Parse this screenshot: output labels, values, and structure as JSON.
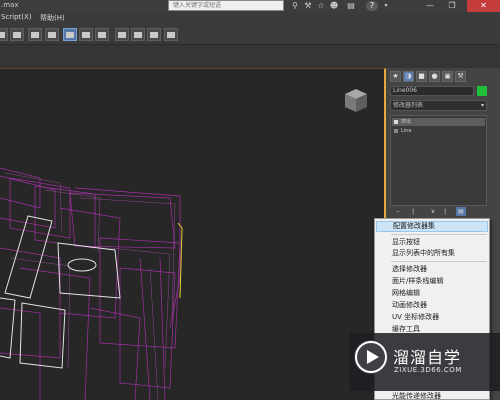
{
  "titlebar": {
    "title": ".max",
    "search_placeholder": "键入关键字或短语",
    "icons": [
      "binoculars-icon",
      "wrench-icon",
      "star-icon",
      "user-icon",
      "cart-icon",
      "help-icon"
    ],
    "help_label": "?"
  },
  "menubar": {
    "items": [
      {
        "label": "Script(X)"
      },
      {
        "label": "帮助(H)"
      }
    ]
  },
  "command_panel": {
    "tabs": [
      "create-tab",
      "modify-tab",
      "hierarchy-tab",
      "motion-tab",
      "display-tab",
      "utilities-tab"
    ],
    "object_name": "Line006",
    "object_color": "#1fbf3a",
    "modifier_list": "修改器列表",
    "stack": [
      {
        "label": "挤出"
      },
      {
        "label": "Line"
      }
    ]
  },
  "context_menu": {
    "items": [
      {
        "label": "配置修改器集"
      },
      {
        "label": "显示按钮"
      },
      {
        "label": "显示列表中的所有集"
      },
      {
        "label": "选择修改器"
      },
      {
        "label": "面片/样条线编辑"
      },
      {
        "label": "网格编辑"
      },
      {
        "label": "动画修改器"
      },
      {
        "label": "UV 坐标修改器"
      },
      {
        "label": "缓存工具"
      },
      {
        "label": "光能传递修改器"
      }
    ]
  },
  "watermark": {
    "title": "溜溜自学",
    "url": "ZIXUE.3D66.COM"
  }
}
